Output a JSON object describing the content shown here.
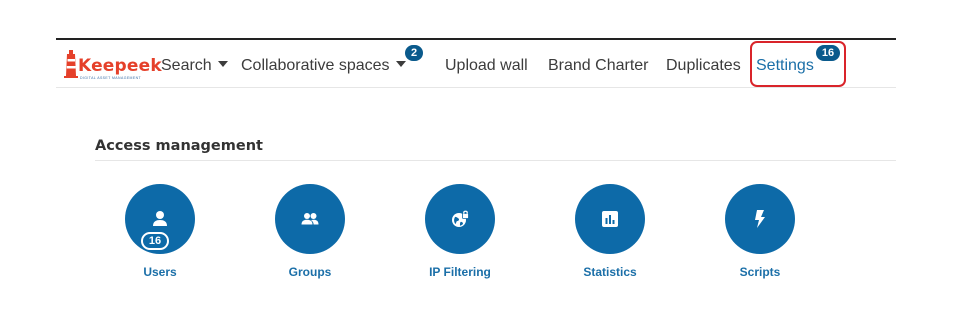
{
  "brand": {
    "name": "Keepeek",
    "tagline": "DIGITAL ASSET MANAGEMENT"
  },
  "nav": {
    "search": "Search",
    "collaborative_spaces": "Collaborative spaces",
    "collaborative_badge": "2",
    "upload_wall": "Upload wall",
    "brand_charter": "Brand Charter",
    "duplicates": "Duplicates",
    "settings": "Settings",
    "settings_badge": "16"
  },
  "section": {
    "title": "Access management"
  },
  "tiles": [
    {
      "label": "Users",
      "icon": "user-icon",
      "badge": "16"
    },
    {
      "label": "Groups",
      "icon": "users-icon"
    },
    {
      "label": "IP Filtering",
      "icon": "globe-lock-icon"
    },
    {
      "label": "Statistics",
      "icon": "bar-chart-icon"
    },
    {
      "label": "Scripts",
      "icon": "bolt-icon"
    }
  ],
  "colors": {
    "accent": "#0d6aa8",
    "logo": "#e5402a",
    "highlight": "#d9242a",
    "badge": "#0a5a8c"
  }
}
